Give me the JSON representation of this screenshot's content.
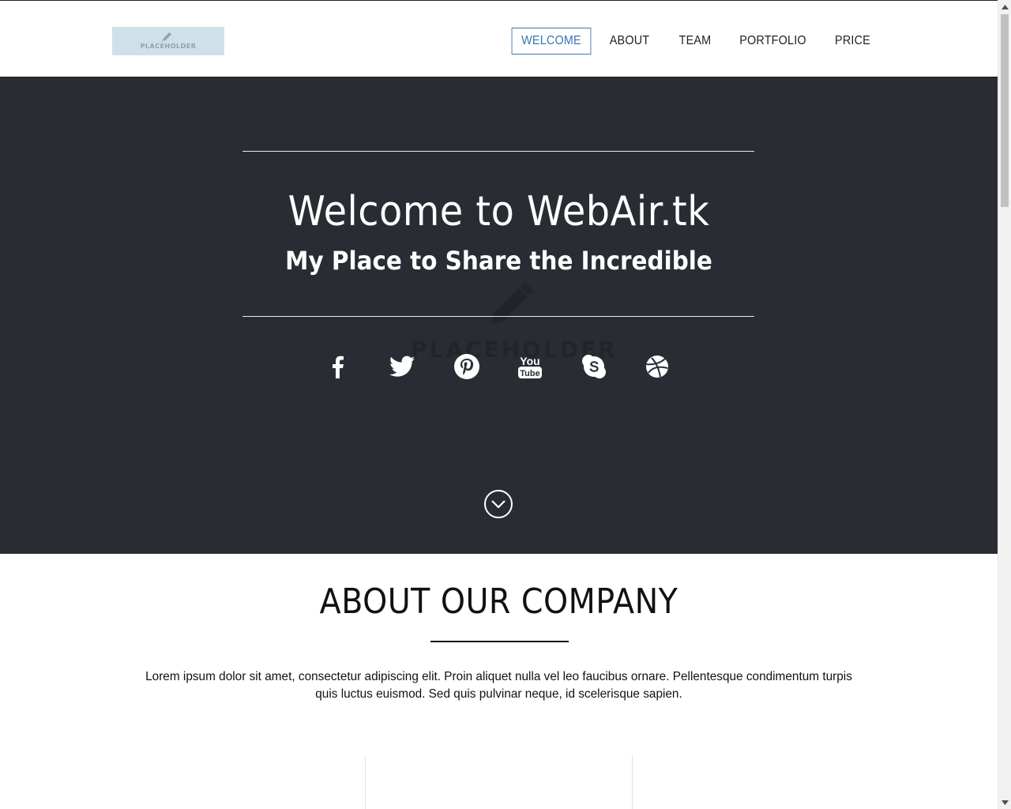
{
  "header": {
    "logo_text": "PLACEHOLDER",
    "nav": [
      {
        "label": "WELCOME",
        "active": true
      },
      {
        "label": "ABOUT",
        "active": false
      },
      {
        "label": "TEAM",
        "active": false
      },
      {
        "label": "PORTFOLIO",
        "active": false
      },
      {
        "label": "PRICE",
        "active": false
      }
    ]
  },
  "hero": {
    "title": "Welcome to WebAir.tk",
    "subtitle": "My Place to Share the Incredible",
    "watermark_text": "PLACEHOLDER",
    "social_icons": [
      "facebook-icon",
      "twitter-icon",
      "pinterest-icon",
      "youtube-icon",
      "skype-icon",
      "dribbble-icon"
    ],
    "youtube_glyph_top": "You",
    "youtube_glyph_bottom": "Tube"
  },
  "about": {
    "title": "ABOUT OUR COMPANY",
    "text": "Lorem ipsum dolor sit amet, consectetur adipiscing elit. Proin aliquet nulla vel leo faucibus ornare. Pellentesque condimentum turpis quis luctus euismod. Sed quis pulvinar neque, id scelerisque sapien."
  },
  "colors": {
    "hero_bg": "#292d33",
    "accent": "#3a76b6",
    "logo_bg": "#cfe0e8"
  }
}
